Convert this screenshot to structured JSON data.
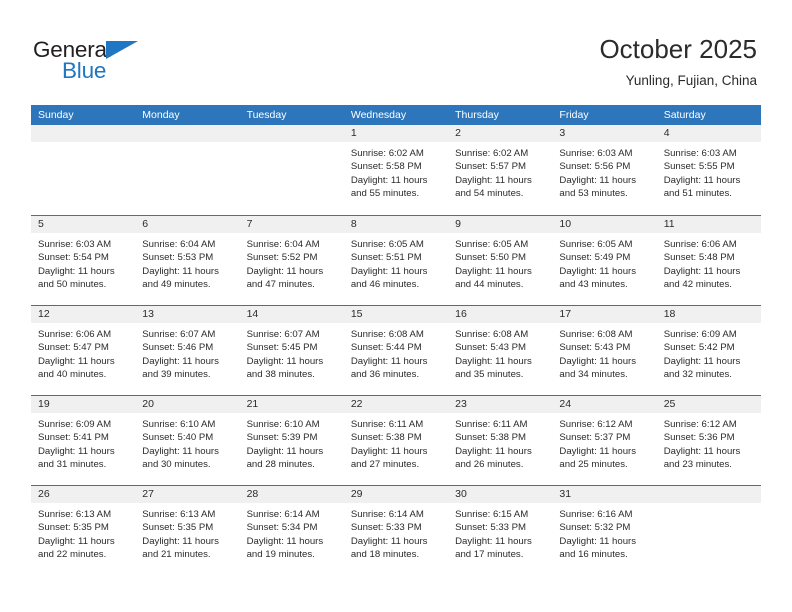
{
  "brand": {
    "logo_word_1": "General",
    "logo_word_2": "Blue",
    "logo_icon": "triangle-flag-icon",
    "color_dark": "#231f20",
    "color_blue": "#1f76c2"
  },
  "header": {
    "title": "October 2025",
    "subtitle": "Yunling, Fujian, China"
  },
  "theme": {
    "header_bar": "#2e76bc",
    "day_number_strip": "#f0f0f0",
    "text": "#2b2b2b",
    "cell_background": "#ffffff"
  },
  "calendar": {
    "weekday_headers": [
      "Sunday",
      "Monday",
      "Tuesday",
      "Wednesday",
      "Thursday",
      "Friday",
      "Saturday"
    ],
    "weeks": [
      [
        {
          "day": "",
          "sunrise": "",
          "sunset": "",
          "daylight_line1": "",
          "daylight_line2": ""
        },
        {
          "day": "",
          "sunrise": "",
          "sunset": "",
          "daylight_line1": "",
          "daylight_line2": ""
        },
        {
          "day": "",
          "sunrise": "",
          "sunset": "",
          "daylight_line1": "",
          "daylight_line2": ""
        },
        {
          "day": "1",
          "sunrise": "Sunrise: 6:02 AM",
          "sunset": "Sunset: 5:58 PM",
          "daylight_line1": "Daylight: 11 hours",
          "daylight_line2": "and 55 minutes."
        },
        {
          "day": "2",
          "sunrise": "Sunrise: 6:02 AM",
          "sunset": "Sunset: 5:57 PM",
          "daylight_line1": "Daylight: 11 hours",
          "daylight_line2": "and 54 minutes."
        },
        {
          "day": "3",
          "sunrise": "Sunrise: 6:03 AM",
          "sunset": "Sunset: 5:56 PM",
          "daylight_line1": "Daylight: 11 hours",
          "daylight_line2": "and 53 minutes."
        },
        {
          "day": "4",
          "sunrise": "Sunrise: 6:03 AM",
          "sunset": "Sunset: 5:55 PM",
          "daylight_line1": "Daylight: 11 hours",
          "daylight_line2": "and 51 minutes."
        }
      ],
      [
        {
          "day": "5",
          "sunrise": "Sunrise: 6:03 AM",
          "sunset": "Sunset: 5:54 PM",
          "daylight_line1": "Daylight: 11 hours",
          "daylight_line2": "and 50 minutes."
        },
        {
          "day": "6",
          "sunrise": "Sunrise: 6:04 AM",
          "sunset": "Sunset: 5:53 PM",
          "daylight_line1": "Daylight: 11 hours",
          "daylight_line2": "and 49 minutes."
        },
        {
          "day": "7",
          "sunrise": "Sunrise: 6:04 AM",
          "sunset": "Sunset: 5:52 PM",
          "daylight_line1": "Daylight: 11 hours",
          "daylight_line2": "and 47 minutes."
        },
        {
          "day": "8",
          "sunrise": "Sunrise: 6:05 AM",
          "sunset": "Sunset: 5:51 PM",
          "daylight_line1": "Daylight: 11 hours",
          "daylight_line2": "and 46 minutes."
        },
        {
          "day": "9",
          "sunrise": "Sunrise: 6:05 AM",
          "sunset": "Sunset: 5:50 PM",
          "daylight_line1": "Daylight: 11 hours",
          "daylight_line2": "and 44 minutes."
        },
        {
          "day": "10",
          "sunrise": "Sunrise: 6:05 AM",
          "sunset": "Sunset: 5:49 PM",
          "daylight_line1": "Daylight: 11 hours",
          "daylight_line2": "and 43 minutes."
        },
        {
          "day": "11",
          "sunrise": "Sunrise: 6:06 AM",
          "sunset": "Sunset: 5:48 PM",
          "daylight_line1": "Daylight: 11 hours",
          "daylight_line2": "and 42 minutes."
        }
      ],
      [
        {
          "day": "12",
          "sunrise": "Sunrise: 6:06 AM",
          "sunset": "Sunset: 5:47 PM",
          "daylight_line1": "Daylight: 11 hours",
          "daylight_line2": "and 40 minutes."
        },
        {
          "day": "13",
          "sunrise": "Sunrise: 6:07 AM",
          "sunset": "Sunset: 5:46 PM",
          "daylight_line1": "Daylight: 11 hours",
          "daylight_line2": "and 39 minutes."
        },
        {
          "day": "14",
          "sunrise": "Sunrise: 6:07 AM",
          "sunset": "Sunset: 5:45 PM",
          "daylight_line1": "Daylight: 11 hours",
          "daylight_line2": "and 38 minutes."
        },
        {
          "day": "15",
          "sunrise": "Sunrise: 6:08 AM",
          "sunset": "Sunset: 5:44 PM",
          "daylight_line1": "Daylight: 11 hours",
          "daylight_line2": "and 36 minutes."
        },
        {
          "day": "16",
          "sunrise": "Sunrise: 6:08 AM",
          "sunset": "Sunset: 5:43 PM",
          "daylight_line1": "Daylight: 11 hours",
          "daylight_line2": "and 35 minutes."
        },
        {
          "day": "17",
          "sunrise": "Sunrise: 6:08 AM",
          "sunset": "Sunset: 5:43 PM",
          "daylight_line1": "Daylight: 11 hours",
          "daylight_line2": "and 34 minutes."
        },
        {
          "day": "18",
          "sunrise": "Sunrise: 6:09 AM",
          "sunset": "Sunset: 5:42 PM",
          "daylight_line1": "Daylight: 11 hours",
          "daylight_line2": "and 32 minutes."
        }
      ],
      [
        {
          "day": "19",
          "sunrise": "Sunrise: 6:09 AM",
          "sunset": "Sunset: 5:41 PM",
          "daylight_line1": "Daylight: 11 hours",
          "daylight_line2": "and 31 minutes."
        },
        {
          "day": "20",
          "sunrise": "Sunrise: 6:10 AM",
          "sunset": "Sunset: 5:40 PM",
          "daylight_line1": "Daylight: 11 hours",
          "daylight_line2": "and 30 minutes."
        },
        {
          "day": "21",
          "sunrise": "Sunrise: 6:10 AM",
          "sunset": "Sunset: 5:39 PM",
          "daylight_line1": "Daylight: 11 hours",
          "daylight_line2": "and 28 minutes."
        },
        {
          "day": "22",
          "sunrise": "Sunrise: 6:11 AM",
          "sunset": "Sunset: 5:38 PM",
          "daylight_line1": "Daylight: 11 hours",
          "daylight_line2": "and 27 minutes."
        },
        {
          "day": "23",
          "sunrise": "Sunrise: 6:11 AM",
          "sunset": "Sunset: 5:38 PM",
          "daylight_line1": "Daylight: 11 hours",
          "daylight_line2": "and 26 minutes."
        },
        {
          "day": "24",
          "sunrise": "Sunrise: 6:12 AM",
          "sunset": "Sunset: 5:37 PM",
          "daylight_line1": "Daylight: 11 hours",
          "daylight_line2": "and 25 minutes."
        },
        {
          "day": "25",
          "sunrise": "Sunrise: 6:12 AM",
          "sunset": "Sunset: 5:36 PM",
          "daylight_line1": "Daylight: 11 hours",
          "daylight_line2": "and 23 minutes."
        }
      ],
      [
        {
          "day": "26",
          "sunrise": "Sunrise: 6:13 AM",
          "sunset": "Sunset: 5:35 PM",
          "daylight_line1": "Daylight: 11 hours",
          "daylight_line2": "and 22 minutes."
        },
        {
          "day": "27",
          "sunrise": "Sunrise: 6:13 AM",
          "sunset": "Sunset: 5:35 PM",
          "daylight_line1": "Daylight: 11 hours",
          "daylight_line2": "and 21 minutes."
        },
        {
          "day": "28",
          "sunrise": "Sunrise: 6:14 AM",
          "sunset": "Sunset: 5:34 PM",
          "daylight_line1": "Daylight: 11 hours",
          "daylight_line2": "and 19 minutes."
        },
        {
          "day": "29",
          "sunrise": "Sunrise: 6:14 AM",
          "sunset": "Sunset: 5:33 PM",
          "daylight_line1": "Daylight: 11 hours",
          "daylight_line2": "and 18 minutes."
        },
        {
          "day": "30",
          "sunrise": "Sunrise: 6:15 AM",
          "sunset": "Sunset: 5:33 PM",
          "daylight_line1": "Daylight: 11 hours",
          "daylight_line2": "and 17 minutes."
        },
        {
          "day": "31",
          "sunrise": "Sunrise: 6:16 AM",
          "sunset": "Sunset: 5:32 PM",
          "daylight_line1": "Daylight: 11 hours",
          "daylight_line2": "and 16 minutes."
        },
        {
          "day": "",
          "sunrise": "",
          "sunset": "",
          "daylight_line1": "",
          "daylight_line2": ""
        }
      ]
    ]
  }
}
